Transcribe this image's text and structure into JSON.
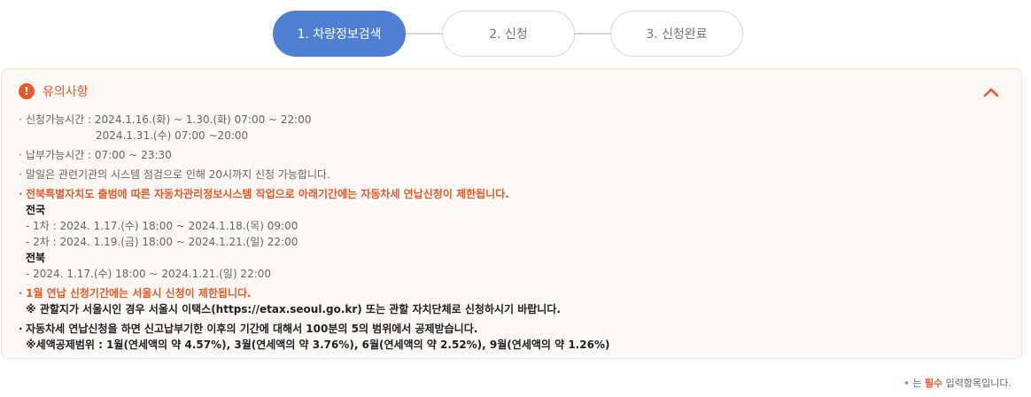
{
  "steps": [
    {
      "label": "1. 차량정보검색",
      "active": true
    },
    {
      "label": "2. 신청",
      "active": false
    },
    {
      "label": "3. 신청완료",
      "active": false
    }
  ],
  "notice": {
    "icon": "exclamation-icon",
    "title": "유의사항",
    "collapse_icon": "chevron-up-icon",
    "accent_color": "#e8582b",
    "lines": {
      "apply_time_1": "신청가능시간 : 2024.1.16.(화) ~ 1.30.(화) 07:00 ~ 22:00",
      "apply_time_2": "2024.1.31.(수) 07:00 ~20:00",
      "pay_time": "납부가능시간 : 07:00 ~ 23:30",
      "month_end": "말일은 관련기관의 시스템 점검으로 인해 20시까지 신청 가능합니다.",
      "restrict_title": "전북특별자치도 출범에 따른 자동차관리정보시스템 작업으로 아래기간에는 자동차세 연납신청이 제한됩니다.",
      "nation_label": "전국",
      "nation_1": "- 1차 : 2024. 1.17.(수) 18:00 ~ 2024.1.18.(목) 09:00",
      "nation_2": "- 2차 : 2024. 1.19.(금) 18:00 ~ 2024.1.21.(일) 22:00",
      "jeonbuk_label": "전북",
      "jeonbuk_1": "- 2024. 1.17.(수) 18:00 ~ 2024.1.21.(일) 22:00",
      "seoul_title": "1월 연납 신청기간에는 서울시 신청이 제한됩니다.",
      "seoul_note": "※ 관할지가 서울시인 경우 서울시 이택스(https://etax.seoul.go.kr) 또는 관할 자치단체로 신청하시기 바랍니다.",
      "deduct_1": "자동차세 연납신청을 하면 신고납부기한 이후의 기간에 대해서 100분의 5의 범위에서 공제받습니다.",
      "deduct_2": "※세액공제범위 : 1월(연세액의 약 4.57%), 3월(연세액의 약 3.76%), 6월(연세액의 약 2.52%), 9월(연세액의 약 1.26%)"
    }
  },
  "footnote": {
    "star": "•",
    "middle": " 는 ",
    "required": "필수",
    "tail": " 입력항목입니다."
  }
}
